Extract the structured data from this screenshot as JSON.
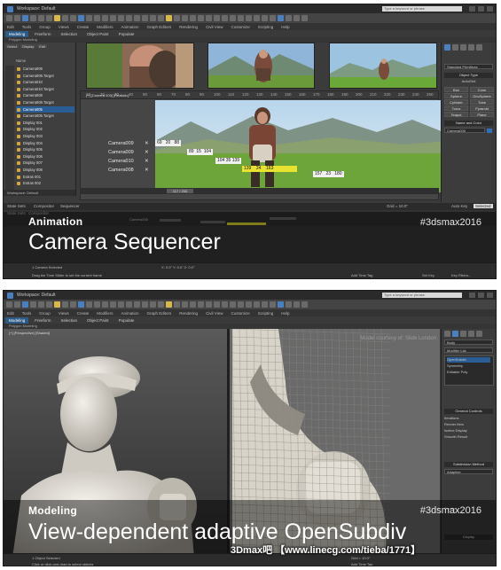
{
  "top": {
    "window_title": "Workspace: Default",
    "search_placeholder": "Type a keyword or phrase",
    "menus": [
      "Edit",
      "Tools",
      "Group",
      "Views",
      "Create",
      "Modifiers",
      "Animation",
      "Graph Editors",
      "Rendering",
      "Civil View",
      "Customize",
      "Scripting",
      "Help"
    ],
    "ribbon_tabs": [
      "Modeling",
      "Freeform",
      "Selection",
      "Object Paint",
      "Populate"
    ],
    "ribbon_sub": "Polygon Modeling",
    "explorer_tabs": [
      "Select",
      "Display",
      "Edit"
    ],
    "explorer_header": "Name",
    "explorer_items": [
      "Camera009",
      "Camera009.Target",
      "Camera010",
      "Camera010.Target",
      "Camera008",
      "Camera008.Target",
      "Camera005",
      "Camera005.Target",
      "Display 001",
      "Display 002",
      "Display 003",
      "Display 004",
      "Display 005",
      "Display 006",
      "Display 007",
      "Display 008",
      "Extras 001",
      "Extras 002"
    ],
    "explorer_footer": "Workspace: Default",
    "viewport_label": "[+] [Camera 005] [Realistic]",
    "ruler_numbers": [
      "10",
      "20",
      "30",
      "40",
      "50",
      "60",
      "70",
      "80",
      "90",
      "100",
      "110",
      "120",
      "130",
      "140",
      "150",
      "160",
      "170",
      "180",
      "190",
      "200",
      "210",
      "220",
      "230",
      "240",
      "250"
    ],
    "cameras": [
      {
        "name": "Camera009",
        "values": [
          "69",
          "20",
          "88"
        ]
      },
      {
        "name": "Camera009",
        "values": [
          "89",
          "15",
          "104"
        ]
      },
      {
        "name": "Camera010",
        "values": [
          "104",
          "35",
          "139"
        ]
      },
      {
        "name": "Camera008",
        "values": [
          "139",
          "24",
          "163"
        ]
      }
    ],
    "last_clip": [
      "157",
      "23",
      "180"
    ],
    "timeline_clip": "117 / 200",
    "cmd": {
      "object_type": "Object Type",
      "standard_primitives": "Standard Primitives",
      "autogrid": "AutoGrid",
      "buttons": [
        "Box",
        "Cone",
        "Sphere",
        "GeoSphere",
        "Cylinder",
        "Tube",
        "Torus",
        "Pyramid",
        "Teapot",
        "Plane"
      ],
      "name_color": "Name and Color",
      "name_value": "Camera005"
    },
    "mini_timeline": {
      "labels": [
        "State Sets",
        "Compositor",
        "Sequencer"
      ],
      "row_labels": [
        "State Sets",
        "Compositor"
      ],
      "auto_key": "Auto Key",
      "selected": "Selected",
      "grid": "Grid = 10.0\"",
      "clips": [
        "Camera005",
        "Camera009",
        "Camera010",
        "Camera008"
      ]
    },
    "status": {
      "selected": "1 Camera Selected",
      "hint": "Drag the Time Slider to set the current frame",
      "coords": "X: 0.0\"  Y: 0.0\"  Z: 0.0\"",
      "set_key": "Set Key",
      "key_filters": "Key Filters...",
      "add_time_tag": "Add Time Tag"
    },
    "caption": {
      "category": "Animation",
      "title": "Camera Sequencer",
      "tag": "#3dsmax2016"
    }
  },
  "bottom": {
    "window_title": "Workspace: Default",
    "search_placeholder": "Type a keyword or phrase",
    "menus": [
      "Edit",
      "Tools",
      "Group",
      "Views",
      "Create",
      "Modifiers",
      "Animation",
      "Graph Editors",
      "Rendering",
      "Civil View",
      "Customize",
      "Scripting",
      "Help"
    ],
    "ribbon_tabs": [
      "Modeling",
      "Freeform",
      "Selection",
      "Object Paint",
      "Populate"
    ],
    "ribbon_sub": "Polygon Modeling",
    "viewport_label": "[+] [Perspective] [Shaded]",
    "credit": "Model courtesy of: Slide London",
    "cmd": {
      "object_name": "Body",
      "modifier_list": "Modifier List",
      "stack": [
        "OpenSubdiv",
        "Symmetry",
        "Editable Poly"
      ],
      "rollouts": [
        "General Controls",
        "Subdivision Method",
        "Display"
      ],
      "fields": [
        "Iterations",
        "Render Iters",
        "Isoline Display",
        "Smooth Result"
      ],
      "adaptive": "Adaptive",
      "crease": "Crease"
    },
    "status": {
      "selected": "1 Object Selected",
      "hint": "Click or click-and-drag to select objects",
      "grid": "Grid = 10.0\"",
      "add_time_tag": "Add Time Tag"
    },
    "caption": {
      "category": "Modeling",
      "title": "View-dependent adaptive OpenSubdiv",
      "tag": "#3dsmax2016"
    }
  },
  "watermark": "3Dmax吧 【www.linecg.com/tieba/1771】"
}
